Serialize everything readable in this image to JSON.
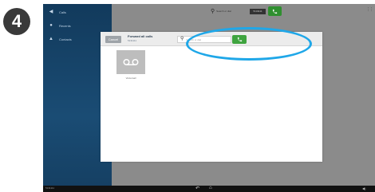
{
  "step": {
    "number": "4"
  },
  "sidebar": {
    "items": [
      {
        "icon": "back-arrow-icon",
        "glyph": "◀",
        "label": "Calls"
      },
      {
        "icon": "recents-icon",
        "glyph": "●",
        "label": "Recents"
      },
      {
        "icon": "contacts-icon",
        "glyph": "▲",
        "label": "Contacts"
      }
    ]
  },
  "topbar": {
    "search_label": "Search or dial",
    "field_value": "5131111"
  },
  "dialog": {
    "cancel_label": "Cancel",
    "title": "Forward all calls",
    "subtitle": "5131111",
    "search_placeholder": "Search or dial",
    "search_value": ""
  },
  "voicemail": {
    "label": "Voicemail"
  },
  "bottombar": {
    "left_text": "5131111",
    "back_glyph": "↶",
    "home_glyph": "⌂",
    "right_text": "◀)"
  },
  "colors": {
    "highlight": "#1fa7e8",
    "call_green": "#3fa43f",
    "sidebar_blue": "#1a4c74"
  }
}
